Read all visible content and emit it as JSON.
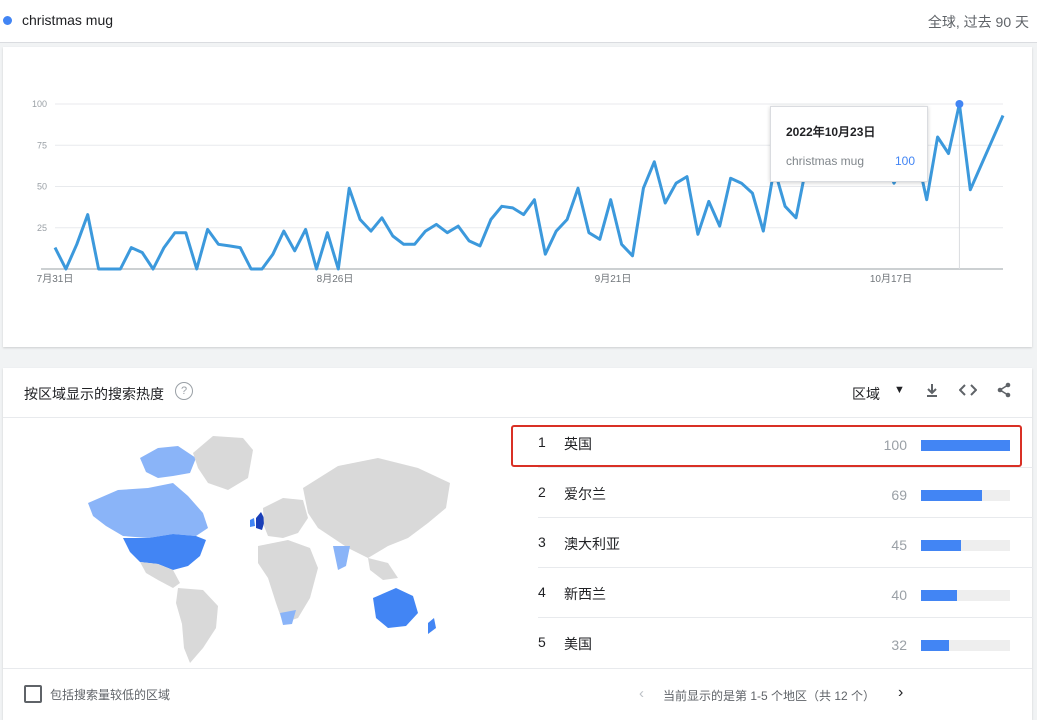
{
  "header": {
    "search_term": "christmas mug",
    "scope": "全球, 过去 90 天"
  },
  "chart_data": {
    "type": "line",
    "y_ticks": [
      "100",
      "75",
      "50",
      "25"
    ],
    "x_labels": [
      "7月31日",
      "8月26日",
      "9月21日",
      "10月17日"
    ],
    "ylim": [
      0,
      100
    ],
    "series": [
      {
        "name": "christmas mug",
        "color": "#3c99dc",
        "values": [
          13,
          0,
          15,
          33,
          0,
          0,
          0,
          13,
          10,
          0,
          13,
          22,
          22,
          0,
          24,
          15,
          14,
          13,
          0,
          0,
          9,
          23,
          11,
          24,
          0,
          22,
          0,
          49,
          30,
          23,
          31,
          20,
          15,
          15,
          23,
          27,
          22,
          26,
          17,
          14,
          30,
          38,
          37,
          33,
          42,
          9,
          23,
          30,
          49,
          22,
          18,
          42,
          15,
          8,
          49,
          65,
          40,
          52,
          56,
          21,
          41,
          26,
          55,
          52,
          46,
          23,
          61,
          38,
          31,
          64,
          62,
          58,
          55,
          60,
          66,
          74,
          70,
          52,
          65,
          72,
          42,
          80,
          70,
          100,
          48,
          63,
          78,
          93
        ]
      }
    ],
    "tooltip": {
      "date": "2022年10月23日",
      "term": "christmas mug",
      "value": "100"
    }
  },
  "region": {
    "title": "按区域显示的搜索热度",
    "help": "?",
    "selector_label": "区域",
    "caret": "▼",
    "icons": [
      "download-icon",
      "embed-icon",
      "share-icon"
    ],
    "rows": [
      {
        "rank": "1",
        "name": "英国",
        "value": 100
      },
      {
        "rank": "2",
        "name": "爱尔兰",
        "value": 69
      },
      {
        "rank": "3",
        "name": "澳大利亚",
        "value": 45
      },
      {
        "rank": "4",
        "name": "新西兰",
        "value": 40
      },
      {
        "rank": "5",
        "name": "美国",
        "value": 32
      }
    ],
    "map_colors": {
      "top": "#1a3fb8",
      "high": "#4285f4",
      "mid": "#8ab4f8",
      "none": "#d9d9d9"
    },
    "checkbox_label": "包括搜索量较低的区域",
    "pagination": {
      "prev": "‹",
      "text": "当前显示的是第 1-5 个地区（共 12 个）",
      "next": "›"
    }
  }
}
